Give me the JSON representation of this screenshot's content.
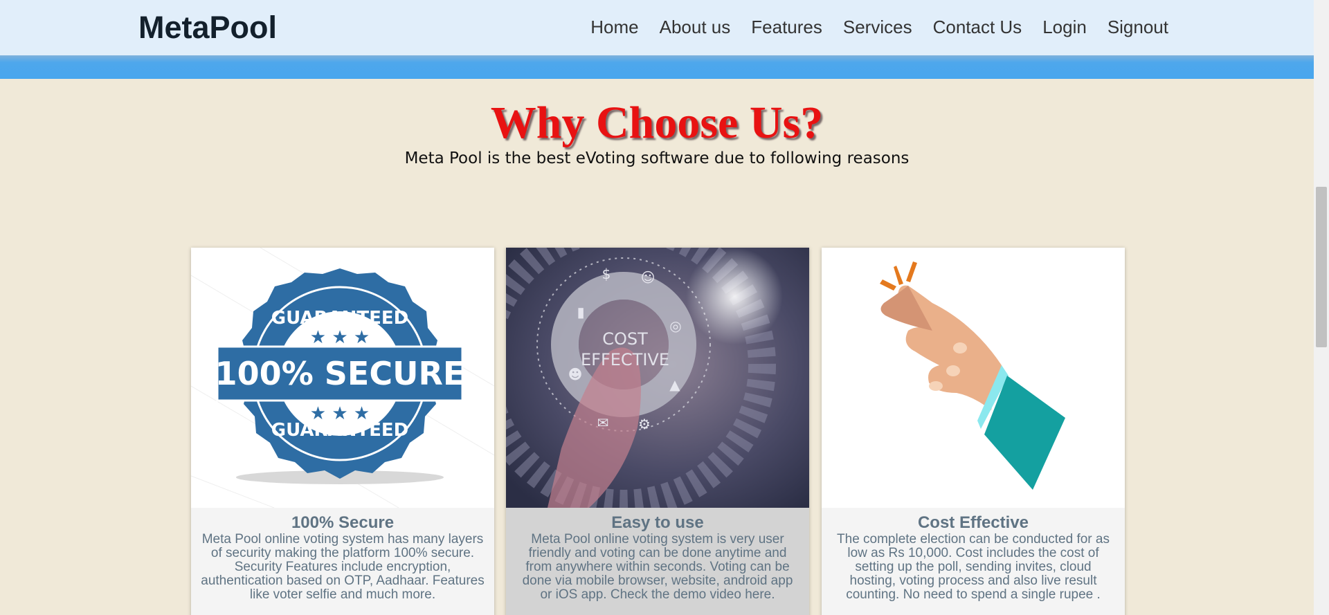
{
  "navbar": {
    "brand": "MetaPool",
    "links": [
      "Home",
      "About us",
      "Features",
      "Services",
      "Contact Us",
      "Login",
      "Signout"
    ]
  },
  "hero": {
    "title": "Why Choose Us?",
    "subtitle": "Meta Pool is the best eVoting software due to following reasons"
  },
  "cards": [
    {
      "title": "100% Secure",
      "text": "Meta Pool online voting system has many layers of security making the platform 100% secure. Security Features include encryption, authentication based on OTP, Aadhaar. Features like voter selfie and much more.",
      "badge": {
        "top": "GUARANTEED",
        "middle": "100% SECURE",
        "bottom": "GUARANTEED"
      }
    },
    {
      "title": "Easy to use",
      "text": "Meta Pool online voting system is very user friendly and voting can be done anytime and from anywhere within seconds. Voting can be done via mobile browser, website, android app or iOS app. Check the demo video here.",
      "image_text": [
        "COST",
        "EFFECTIVE"
      ]
    },
    {
      "title": "Cost Effective",
      "text": "The complete election can be conducted for as low as Rs 10,000. Cost includes the cost of setting up the poll, sending invites, cloud hosting, voting process and also live result counting. No need to spend a single rupee ."
    }
  ],
  "colors": {
    "accent_title": "#e81212",
    "navbar_bg": "#e1eefa",
    "bluebar": "#48a6ee",
    "badge_blue": "#2e6da4",
    "card_text": "#5f7383"
  }
}
